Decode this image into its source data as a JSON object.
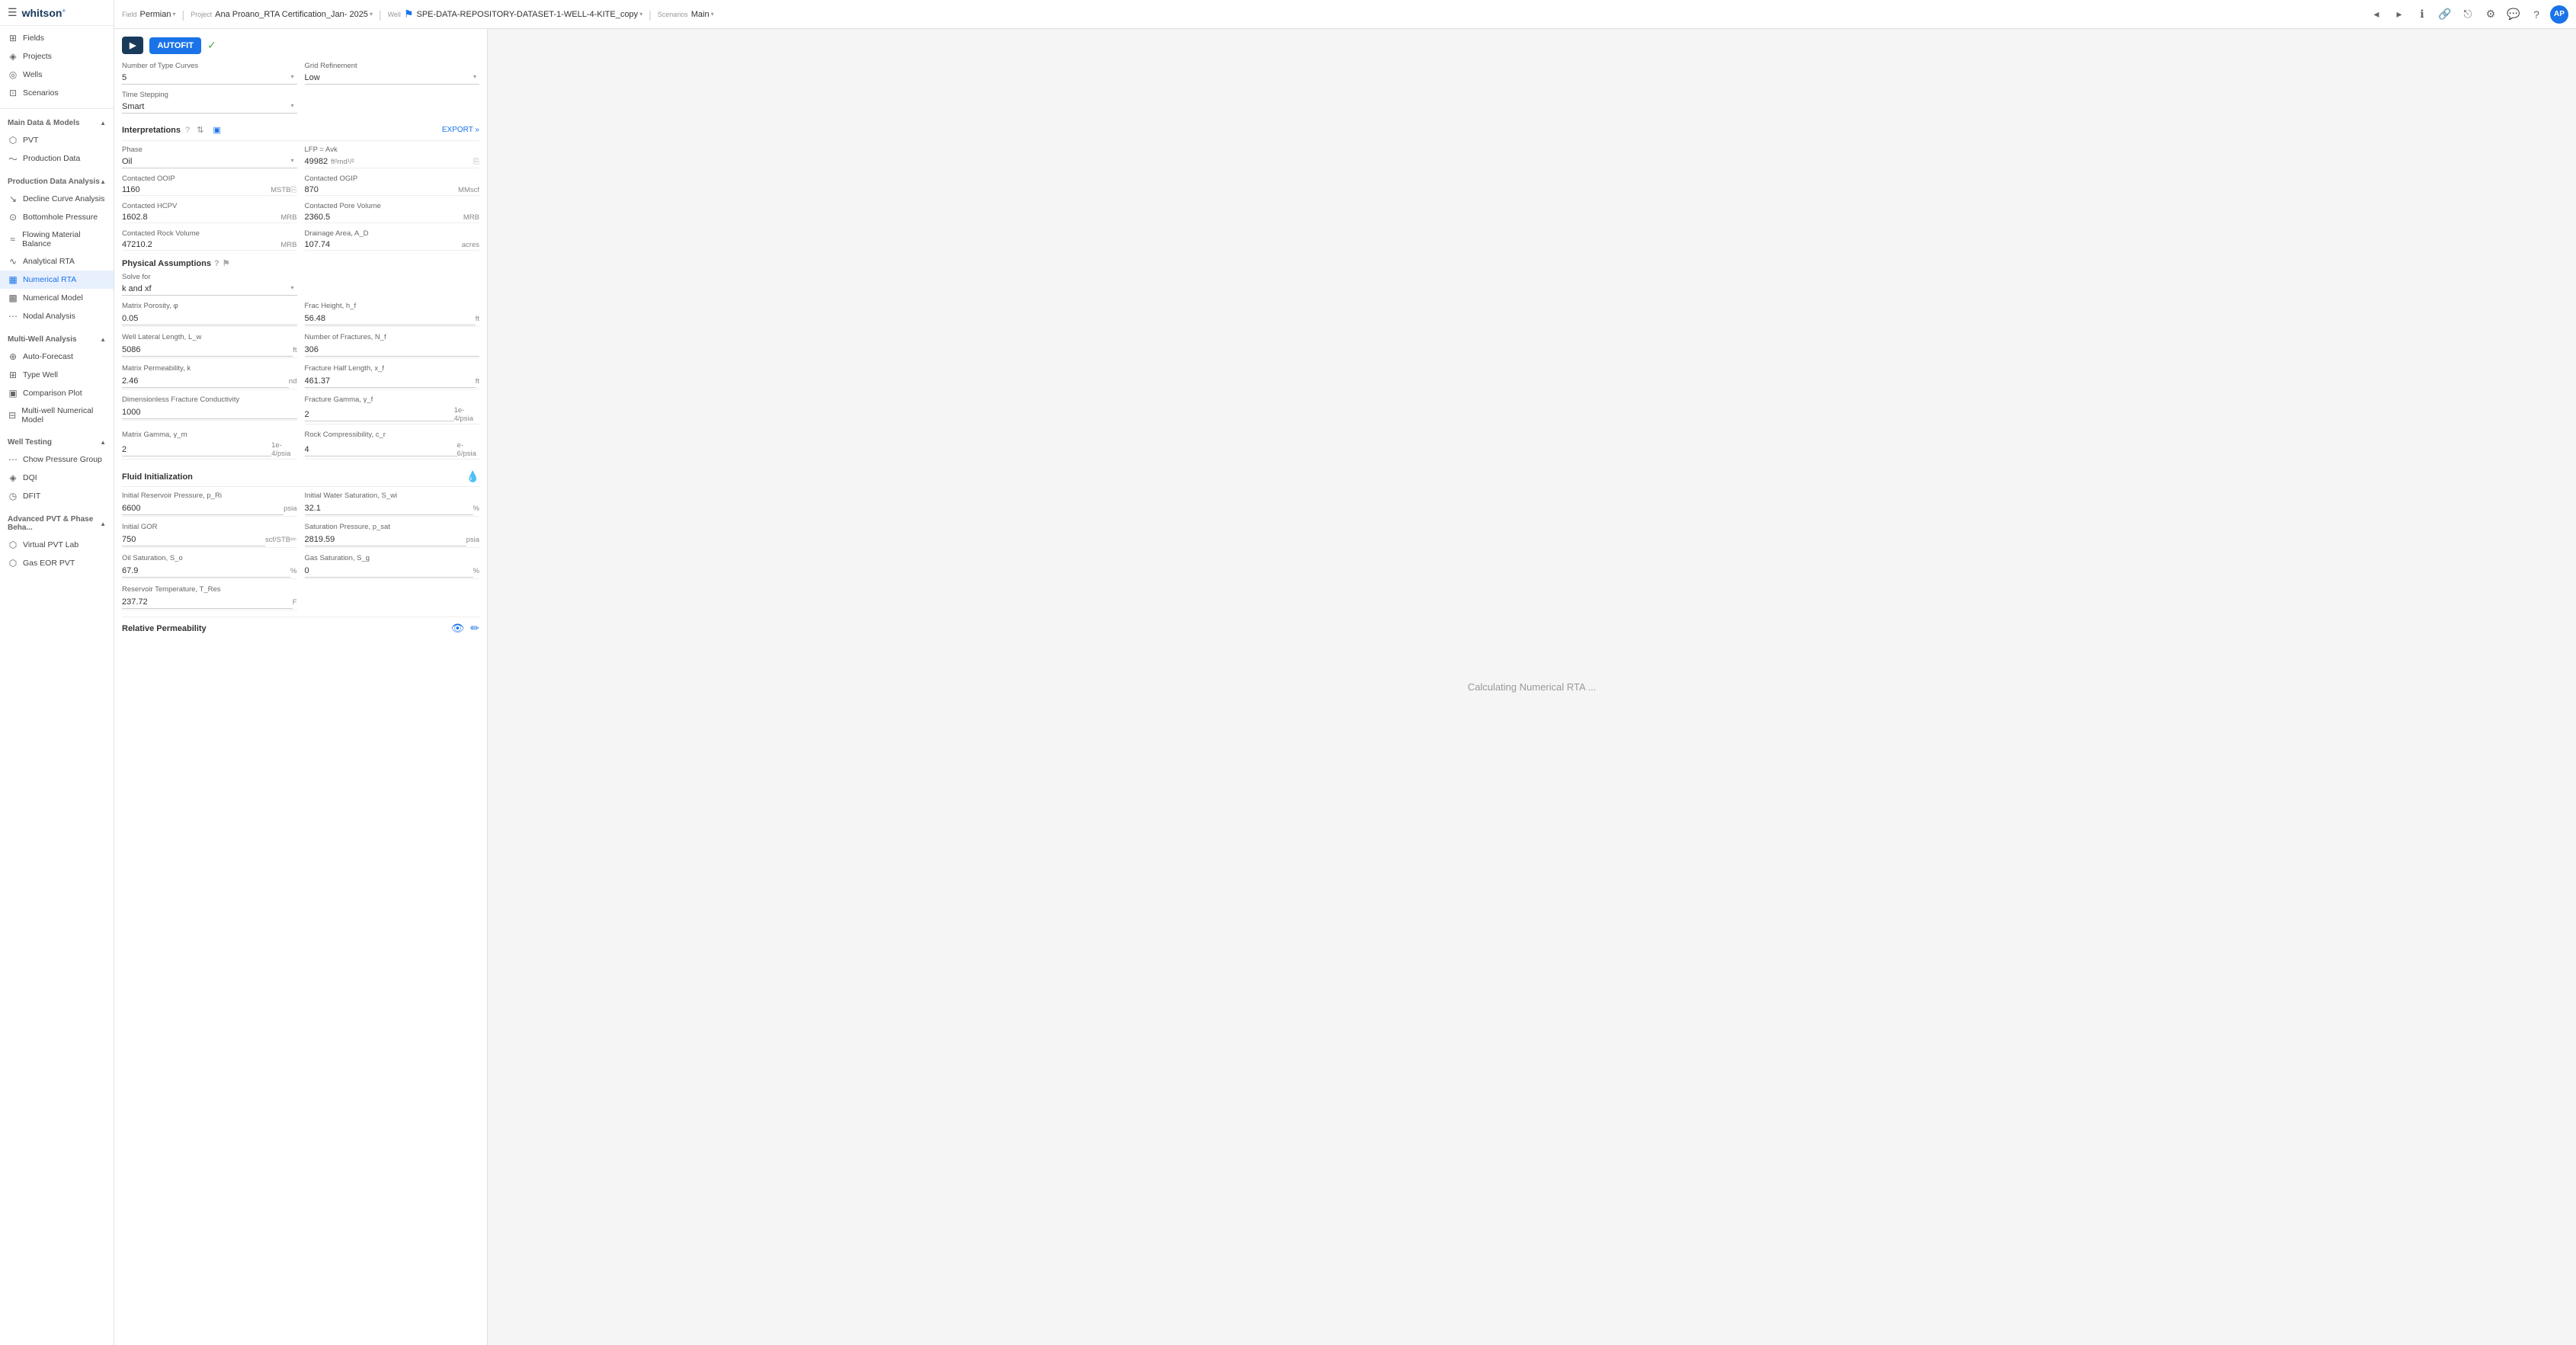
{
  "app": {
    "name": "whitson",
    "logo_plus": "+"
  },
  "topbar": {
    "field_label": "Field",
    "field_value": "Permian",
    "project_label": "Project",
    "project_value": "Ana Proano_RTA Certification_Jan- 2025",
    "well_label": "Well",
    "well_value": "SPE-DATA-REPOSITORY-DATASET-1-WELL-4-KITE_copy",
    "scenarios_label": "Scenarios",
    "scenarios_value": "Main"
  },
  "sidebar": {
    "fields_label": "Fields",
    "projects_label": "Projects",
    "wells_label": "Wells",
    "scenarios_label": "Scenarios",
    "main_data_models_label": "Main Data & Models",
    "pvt_label": "PVT",
    "production_data_label": "Production Data",
    "production_data_analysis_label": "Production Data Analysis",
    "decline_curve_label": "Decline Curve Analysis",
    "bottomhole_pressure_label": "Bottomhole Pressure",
    "flowing_material_balance_label": "Flowing Material Balance",
    "analytical_rta_label": "Analytical RTA",
    "numerical_rta_label": "Numerical RTA",
    "numerical_model_label": "Numerical Model",
    "nodal_analysis_label": "Nodal Analysis",
    "multi_well_analysis_label": "Multi-Well Analysis",
    "auto_forecast_label": "Auto-Forecast",
    "type_well_label": "Type Well",
    "comparison_plot_label": "Comparison Plot",
    "multi_well_numerical_label": "Multi-well Numerical Model",
    "well_testing_label": "Well Testing",
    "chow_pressure_label": "Chow Pressure Group",
    "dqi_label": "DQI",
    "dfit_label": "DFIT",
    "advanced_pvt_label": "Advanced PVT & Phase Beha...",
    "virtual_pvt_lab_label": "Virtual PVT Lab",
    "gas_eor_pvt_label": "Gas EOR PVT"
  },
  "controls": {
    "run_label": "▶",
    "autofit_label": "AUTOFIT",
    "check_icon": "✓"
  },
  "number_of_type_curves": {
    "label": "Number of Type Curves",
    "value": "5"
  },
  "time_stepping": {
    "label": "Time Stepping",
    "value": "Smart"
  },
  "grid_refinement": {
    "label": "Grid Refinement",
    "value": "Low"
  },
  "interpretations": {
    "title": "Interpretations",
    "export_label": "EXPORT »",
    "phase_label": "Phase",
    "phase_value": "Oil",
    "lfp_label": "LFP = Avk",
    "lfp_value": "49982",
    "lfp_unit": "ft²md¹/²",
    "contacted_ooip_label": "Contacted OOIP",
    "contacted_ooip_value": "1160",
    "contacted_ooip_unit": "MSTB",
    "contacted_ogip_label": "Contacted OGIP",
    "contacted_ogip_value": "870",
    "contacted_ogip_unit": "MMscf",
    "contacted_hcpv_label": "Contacted HCPV",
    "contacted_hcpv_value": "1602.8",
    "contacted_hcpv_unit": "MRB",
    "contacted_pore_volume_label": "Contacted Pore Volume",
    "contacted_pore_volume_value": "2360.5",
    "contacted_pore_volume_unit": "MRB",
    "contacted_rock_volume_label": "Contacted Rock Volume",
    "contacted_rock_volume_value": "47210.2",
    "contacted_rock_volume_unit": "MRB",
    "drainage_area_label": "Drainage Area, A_D",
    "drainage_area_value": "107.74",
    "drainage_area_unit": "acres"
  },
  "physical_assumptions": {
    "title": "Physical Assumptions",
    "solve_for_label": "Solve for",
    "solve_for_value": "k and xf",
    "matrix_porosity_label": "Matrix Porosity, φ",
    "matrix_porosity_value": "0.05",
    "frac_height_label": "Frac Height, h_f",
    "frac_height_value": "56.48",
    "frac_height_unit": "ft",
    "well_lateral_length_label": "Well Lateral Length, L_w",
    "well_lateral_length_value": "5086",
    "well_lateral_length_unit": "ft",
    "number_of_fractures_label": "Number of Fractures, N_f",
    "number_of_fractures_value": "306",
    "matrix_permeability_label": "Matrix Permeability, k",
    "matrix_permeability_value": "2.46",
    "matrix_permeability_unit": "nd",
    "fracture_half_length_label": "Fracture Half Length, x_f",
    "fracture_half_length_value": "461.37",
    "fracture_half_length_unit": "ft",
    "dimensionless_fracture_conductivity_label": "Dimensionless Fracture Conductivity",
    "dimensionless_fracture_conductivity_value": "1000",
    "fracture_gamma_label": "Fracture Gamma, γ_f",
    "fracture_gamma_value": "2",
    "fracture_gamma_unit": "1e-4/psia",
    "matrix_gamma_label": "Matrix Gamma, γ_m",
    "matrix_gamma_value": "2",
    "matrix_gamma_unit": "1e-4/psia",
    "rock_compressibility_label": "Rock Compressibility, c_r",
    "rock_compressibility_value": "4",
    "rock_compressibility_unit": "e-6/psia"
  },
  "fluid_initialization": {
    "title": "Fluid Initialization",
    "initial_reservoir_pressure_label": "Initial Reservoir Pressure, p_Ri",
    "initial_reservoir_pressure_value": "6600",
    "initial_reservoir_pressure_unit": "psia",
    "initial_water_saturation_label": "Initial Water Saturation, S_wi",
    "initial_water_saturation_value": "32.1",
    "initial_water_saturation_unit": "%",
    "initial_gor_label": "Initial GOR",
    "initial_gor_value": "750",
    "initial_gor_unit": "scf/STB",
    "saturation_pressure_label": "Saturation Pressure, p_sat",
    "saturation_pressure_value": "2819.59",
    "saturation_pressure_unit": "psia",
    "oil_saturation_label": "Oil Saturation, S_o",
    "oil_saturation_value": "67.9",
    "oil_saturation_unit": "%",
    "gas_saturation_label": "Gas Saturation, S_g",
    "gas_saturation_value": "0",
    "gas_saturation_unit": "%",
    "reservoir_temperature_label": "Reservoir Temperature, T_Res",
    "reservoir_temperature_value": "237.72",
    "reservoir_temperature_unit": "F"
  },
  "relative_permeability": {
    "title": "Relative Permeability"
  },
  "main_chart": {
    "calculating_text": "Calculating Numerical RTA ..."
  }
}
